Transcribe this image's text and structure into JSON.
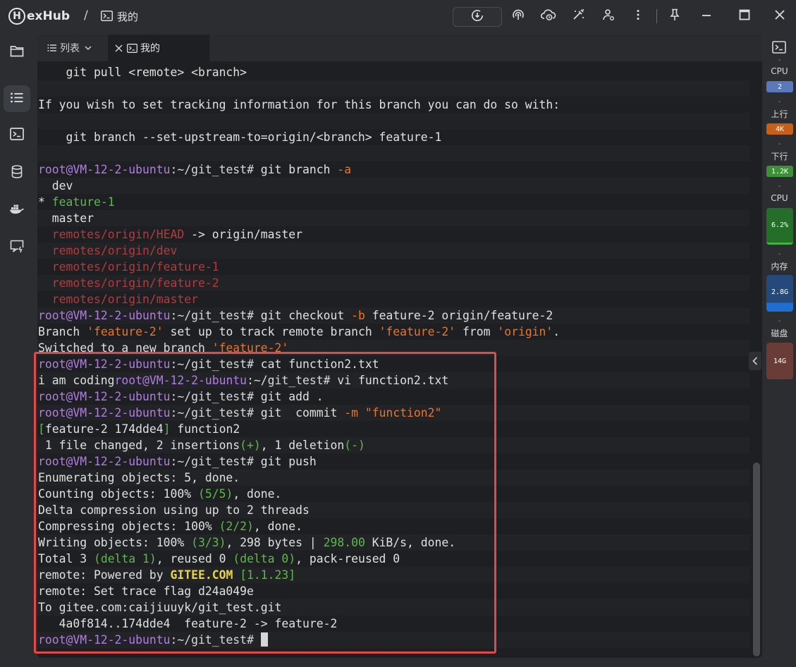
{
  "app": {
    "logo_letter": "H",
    "logo_text": "exHub",
    "breadcrumb_sep": "/",
    "breadcrumb_title": "我的"
  },
  "icons": {
    "terminal": "terminal-icon",
    "folder": "folder-icon",
    "list": "list-icon",
    "database": "database-icon",
    "docker": "docker-icon",
    "cast": "cast-icon",
    "sync": "sync-icon",
    "pin": "pin-icon",
    "minimize": "minimize-icon",
    "maximize": "maximize-icon",
    "close": "close-icon"
  },
  "tabs": {
    "list_label": "列表",
    "active_label": "我的"
  },
  "terminal": {
    "prompt_user": "root@VM-12-2-ubuntu",
    "prompt_path": ":~/git_test",
    "prompt_hash": "#",
    "lines": {
      "l1": "    git pull <remote> <branch>",
      "l2": "If you wish to set tracking information for this branch you can do so with:",
      "l3": "    git branch --set-upstream-to=origin/<branch> feature-1",
      "l4_cmd": " git branch ",
      "l4_flag": "-a",
      "l5": "  dev",
      "l6_star": "* ",
      "l6_branch": "feature-1",
      "l7": "  master",
      "l8_remote": "remotes/origin/HEAD",
      "l8_rest": " -> origin/master",
      "l9": "remotes/origin/dev",
      "l10": "remotes/origin/feature-1",
      "l11": "remotes/origin/feature-2",
      "l12": "remotes/origin/master",
      "l13_cmd": " git checkout ",
      "l13_flag": "-b",
      "l13_rest": " feature-2 origin/feature-2",
      "l14_a": "Branch ",
      "l14_b": "'feature-2'",
      "l14_c": " set up to track remote branch ",
      "l14_d": "'feature-2'",
      "l14_e": " from ",
      "l14_f": "'origin'",
      "l14_g": ".",
      "l15_a": "Switched to a new branch ",
      "l15_b": "'feature-2'",
      "l16_cmd": " cat function2.txt",
      "l17_a": "i am coding",
      "l17_cmd": " vi function2.txt",
      "l18_cmd": " git add .",
      "l19_cmd": " git  commit ",
      "l19_flag": "-m",
      "l19_str": " \"function2\"",
      "l20_a": "[",
      "l20_b": "feature-2 174dde4",
      "l20_c": "]",
      "l20_d": " function2",
      "l21_a": " 1 file changed, 2 insertions",
      "l21_b": "(+)",
      "l21_c": ", 1 deletion",
      "l21_d": "(-)",
      "l22_cmd": " git push",
      "l23": "Enumerating objects: 5, done.",
      "l24_a": "Counting objects: 100% ",
      "l24_b": "(5/5)",
      "l24_c": ", done.",
      "l25": "Delta compression using up to 2 threads",
      "l26_a": "Compressing objects: 100% ",
      "l26_b": "(2/2)",
      "l26_c": ", done.",
      "l27_a": "Writing objects: 100% ",
      "l27_b": "(3/3)",
      "l27_c": ", 298 bytes | ",
      "l27_d": "298.00",
      "l27_e": " KiB/s, done.",
      "l28_a": "Total 3 ",
      "l28_b": "(delta 1)",
      "l28_c": ", reused 0 ",
      "l28_d": "(delta 0)",
      "l28_e": ", pack-reused 0",
      "l29_a": "remote: Powered by ",
      "l29_b": "GITEE.COM",
      "l29_c": " ",
      "l29_d": "[1.1.23]",
      "l30": "remote: Set trace flag d24a049e",
      "l31": "To gitee.com:caijiuuyk/git_test.git",
      "l32": "   4a0f814..174dde4  feature-2 -> feature-2",
      "l33_tail": " "
    }
  },
  "stats": {
    "dash": "-",
    "cpu_label": "CPU",
    "cpu_cores": "2",
    "upload_label": "上行",
    "upload_value": "4K",
    "download_label": "下行",
    "download_value": "1.2K",
    "cpu_usage_label": "CPU",
    "cpu_usage_value": "6.2%",
    "cpu_usage_level": 0.062,
    "mem_label": "内存",
    "mem_value": "2.8G",
    "disk_label": "磁盘",
    "disk_value": "14G"
  },
  "colors": {
    "highlight_border": "#e14a4a",
    "prompt_user": "#b07ee0",
    "flag": "#e8752a",
    "green": "#5fb84b",
    "remote_red": "#b73a3a",
    "gitee_yellow": "#e6d54a"
  }
}
